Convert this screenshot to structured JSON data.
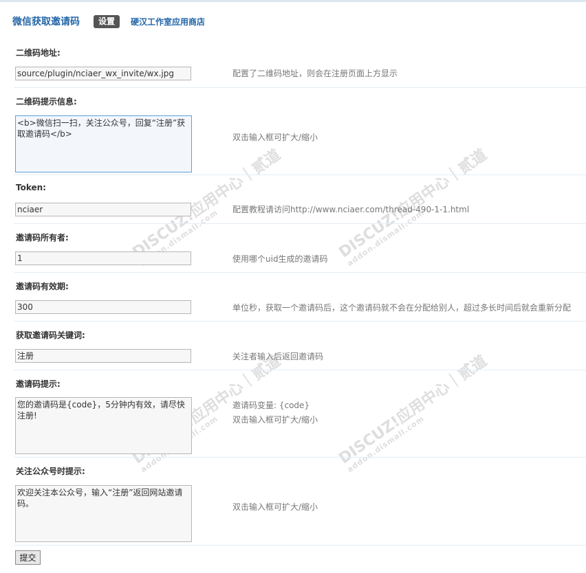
{
  "header": {
    "title": "微信获取邀请码",
    "active_tab": "设置",
    "link_label": "硬汉工作室应用商店"
  },
  "form": {
    "fields": [
      {
        "label": "二维码地址:",
        "value": "source/plugin/nciaer_wx_invite/wx.jpg",
        "hint": "配置了二维码地址，则会在注册页面上方显示"
      },
      {
        "label": "二维码提示信息:",
        "value": "<b>微信扫一扫，关注公众号，回复“注册”获取邀请码</b>",
        "hint": "双击输入框可扩大/缩小"
      },
      {
        "label": "Token:",
        "value": "nciaer",
        "hint": "配置教程请访问http://www.nciaer.com/thread-490-1-1.html"
      },
      {
        "label": "邀请码所有者:",
        "value": "1",
        "hint": "使用哪个uid生成的邀请码"
      },
      {
        "label": "邀请码有效期:",
        "value": "300",
        "hint": "单位秒，获取一个邀请码后，这个邀请码就不会在分配给别人，超过多长时间后就会重新分配"
      },
      {
        "label": "获取邀请码关键词:",
        "value": "注册",
        "hint": "关注者输入后返回邀请码"
      },
      {
        "label": "邀请码提示:",
        "value": "您的邀请码是{code}，5分钟内有效，请尽快注册!",
        "hint_line1": "邀请码变量: {code}",
        "hint_line2": "双击输入框可扩大/缩小"
      },
      {
        "label": "关注公众号时提示:",
        "value": "欢迎关注本公众号，输入“注册”返回网站邀请码。",
        "hint": "双击输入框可扩大/缩小"
      }
    ],
    "submit_label": "提交"
  },
  "watermark": {
    "brand": "DISCUZ!应用中心｜贰道",
    "url": "addon.dismall.com"
  }
}
